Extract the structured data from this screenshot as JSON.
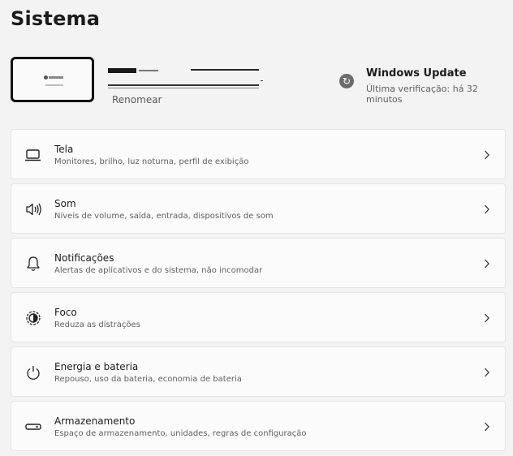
{
  "page": {
    "title": "Sistema"
  },
  "device": {
    "rename_label": "Renomear"
  },
  "windows_update": {
    "title": "Windows Update",
    "subtitle": "Última verificação: há 32 minutos",
    "icon": "sync-icon"
  },
  "settings": [
    {
      "title": "Tela",
      "subtitle": "Monitores, brilho, luz noturna, perfil de exibição",
      "icon": "monitor-icon"
    },
    {
      "title": "Som",
      "subtitle": "Níveis de volume, saída, entrada, dispositivos de som",
      "icon": "speaker-icon"
    },
    {
      "title": "Notificações",
      "subtitle": "Alertas de aplicativos e do sistema, não incomodar",
      "icon": "bell-icon"
    },
    {
      "title": "Foco",
      "subtitle": "Reduza as distrações",
      "icon": "focus-icon"
    },
    {
      "title": "Energia e bateria",
      "subtitle": "Repouso, uso da bateria, economia de bateria",
      "icon": "power-icon"
    },
    {
      "title": "Armazenamento",
      "subtitle": "Espaço de armazenamento, unidades, regras de configuração",
      "icon": "storage-icon"
    }
  ]
}
